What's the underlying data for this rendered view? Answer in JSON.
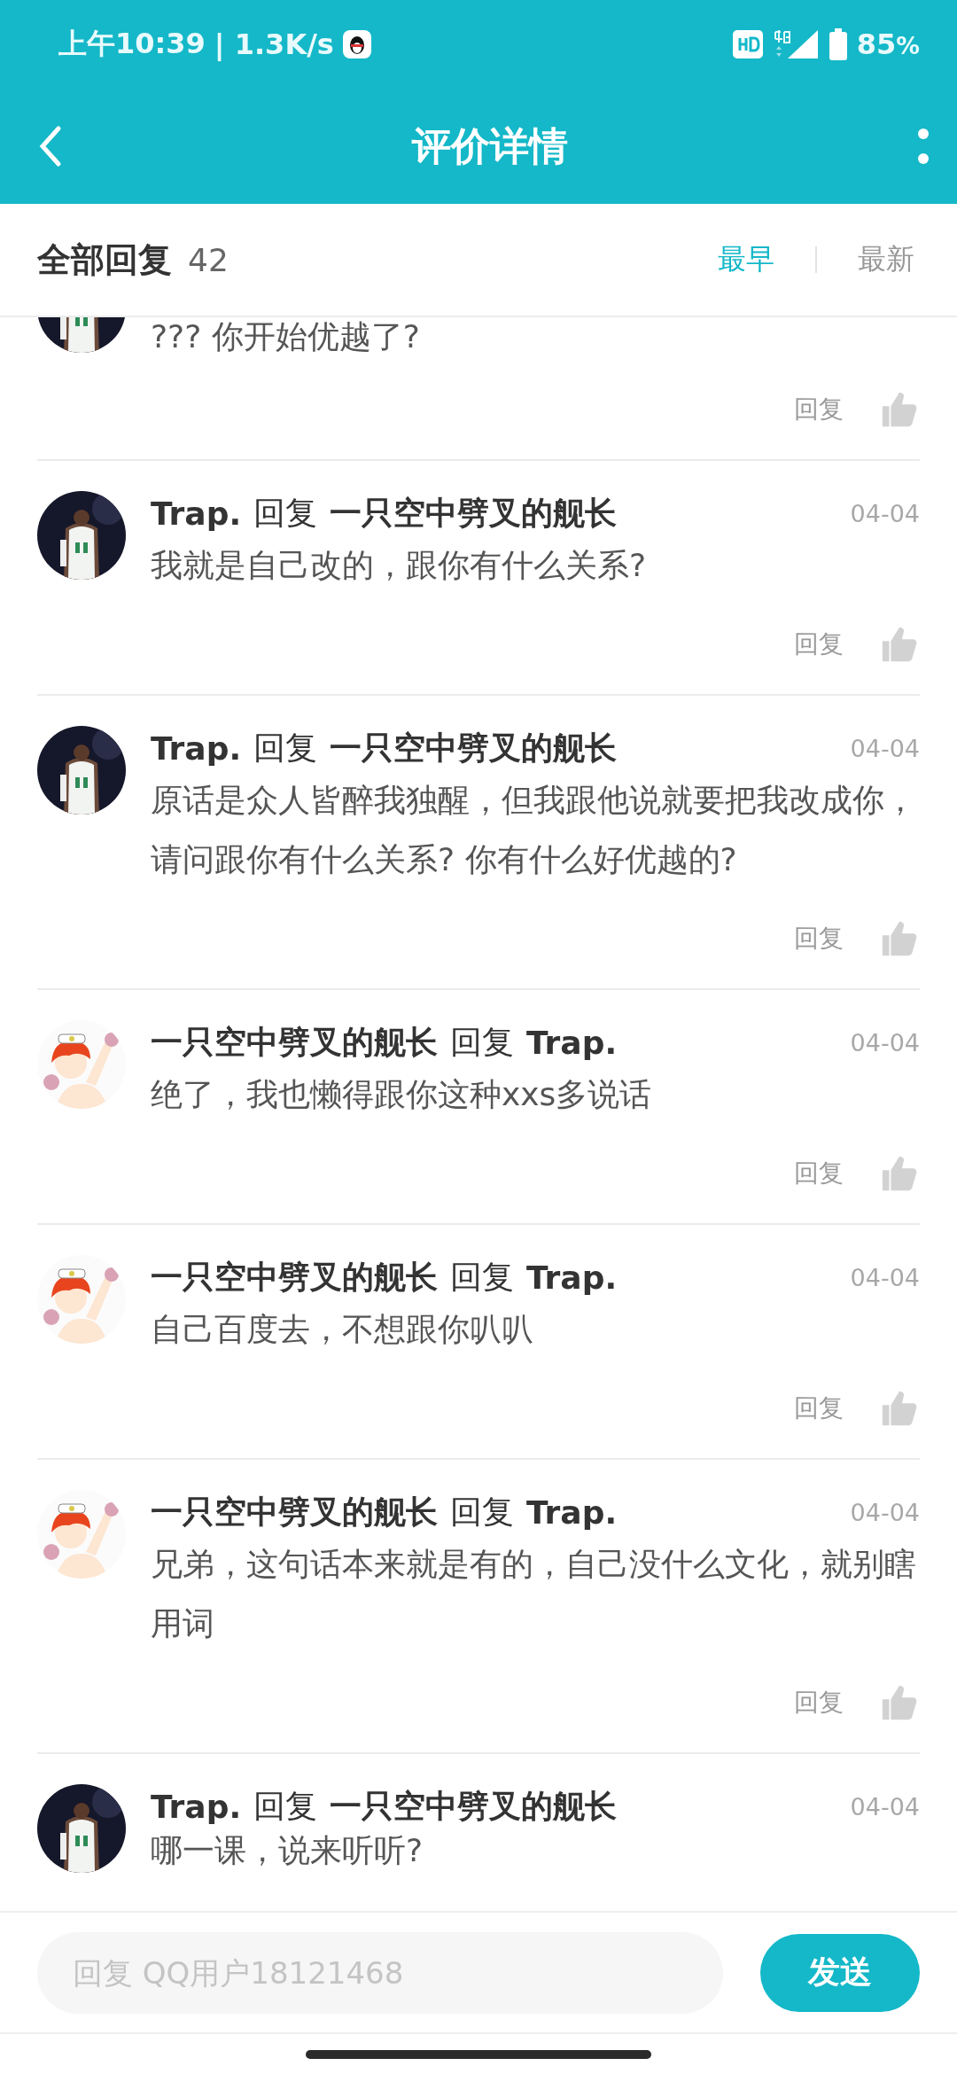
{
  "status_bar": {
    "time": "上午10:39",
    "speed": "| 1.3K/s",
    "battery": "85",
    "battery_unit": "%"
  },
  "app_bar": {
    "title": "评价详情"
  },
  "replies_header": {
    "label": "全部回复",
    "count": "42",
    "sort_tabs": [
      {
        "label": "最早",
        "selected": true
      },
      {
        "label": "最新",
        "selected": false
      }
    ]
  },
  "comments": [
    {
      "kind": "cut",
      "avatar": {
        "kind": "jersey"
      },
      "text": "??? 你开始优越了?",
      "reply": "回复"
    },
    {
      "kind": "full",
      "avatar": {
        "kind": "jersey"
      },
      "author": "Trap.",
      "verb": "回复",
      "target": "一只空中劈叉的舰长",
      "date": "04-04",
      "text": "我就是自己改的，跟你有什么关系?",
      "reply": "回复"
    },
    {
      "kind": "full",
      "avatar": {
        "kind": "jersey"
      },
      "author": "Trap.",
      "verb": "回复",
      "target": "一只空中劈叉的舰长",
      "date": "04-04",
      "text": "原话是众人皆醉我独醒，但我跟他说就要把我改成你，请问跟你有什么关系? 你有什么好优越的?",
      "reply": "回复"
    },
    {
      "kind": "full",
      "avatar": {
        "kind": "cartoon"
      },
      "author": "一只空中劈叉的舰长",
      "verb": "回复",
      "target": "Trap.",
      "date": "04-04",
      "text": "绝了，我也懒得跟你这种xxs多说话",
      "reply": "回复"
    },
    {
      "kind": "full",
      "avatar": {
        "kind": "cartoon"
      },
      "author": "一只空中劈叉的舰长",
      "verb": "回复",
      "target": "Trap.",
      "date": "04-04",
      "text": "自己百度去，不想跟你叭叭",
      "reply": "回复"
    },
    {
      "kind": "full",
      "avatar": {
        "kind": "cartoon"
      },
      "author": "一只空中劈叉的舰长",
      "verb": "回复",
      "target": "Trap.",
      "date": "04-04",
      "text": "兄弟，这句话本来就是有的，自己没什么文化，就别瞎用词",
      "reply": "回复"
    },
    {
      "kind": "last",
      "avatar": {
        "kind": "jersey"
      },
      "author": "Trap.",
      "verb": "回复",
      "target": "一只空中劈叉的舰长",
      "date": "04-04",
      "text": "哪一课，说来听听?"
    }
  ],
  "reply_bar": {
    "placeholder": "回复 QQ用户18121468",
    "send": "发送"
  }
}
